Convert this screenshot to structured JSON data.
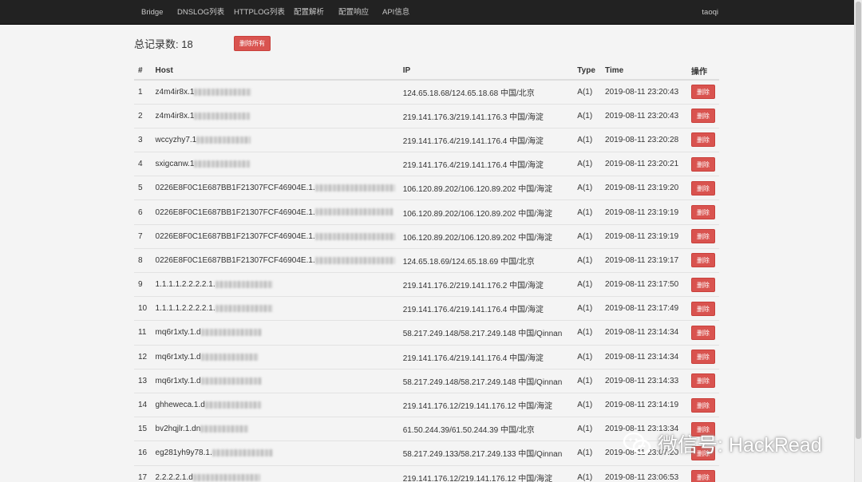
{
  "nav": {
    "items": [
      {
        "label": "Bridge"
      },
      {
        "label": "DNSLOG列表"
      },
      {
        "label": "HTTPLOG列表"
      },
      {
        "label": "配置解析"
      },
      {
        "label": "配置响应"
      },
      {
        "label": "API信息"
      }
    ],
    "user": "taoqi"
  },
  "summary": {
    "total_label": "总记录数: 18",
    "delete_all_label": "删除所有"
  },
  "table": {
    "headers": {
      "num": "#",
      "host": "Host",
      "ip": "IP",
      "type": "Type",
      "time": "Time",
      "action": "操作"
    },
    "delete_label": "删除",
    "rows": [
      {
        "num": "1",
        "host": "z4m4ir8x.1",
        "ip": "124.65.18.68/124.65.18.68 中国/北京",
        "type": "A(1)",
        "time": "2019-08-11 23:20:43"
      },
      {
        "num": "2",
        "host": "z4m4ir8x.1",
        "ip": "219.141.176.3/219.141.176.3 中国/海淀",
        "type": "A(1)",
        "time": "2019-08-11 23:20:43"
      },
      {
        "num": "3",
        "host": "wccyzhy7.1",
        "ip": "219.141.176.4/219.141.176.4 中国/海淀",
        "type": "A(1)",
        "time": "2019-08-11 23:20:28"
      },
      {
        "num": "4",
        "host": "sxigcanw.1",
        "ip": "219.141.176.4/219.141.176.4 中国/海淀",
        "type": "A(1)",
        "time": "2019-08-11 23:20:21"
      },
      {
        "num": "5",
        "host": "0226E8F0C1E687BB1F21307FCF46904E.1.",
        "ip": "106.120.89.202/106.120.89.202 中国/海淀",
        "type": "A(1)",
        "time": "2019-08-11 23:19:20"
      },
      {
        "num": "6",
        "host": "0226E8F0C1E687BB1F21307FCF46904E.1.",
        "ip": "106.120.89.202/106.120.89.202 中国/海淀",
        "type": "A(1)",
        "time": "2019-08-11 23:19:19"
      },
      {
        "num": "7",
        "host": "0226E8F0C1E687BB1F21307FCF46904E.1.",
        "ip": "106.120.89.202/106.120.89.202 中国/海淀",
        "type": "A(1)",
        "time": "2019-08-11 23:19:19"
      },
      {
        "num": "8",
        "host": "0226E8F0C1E687BB1F21307FCF46904E.1.",
        "ip": "124.65.18.69/124.65.18.69 中国/北京",
        "type": "A(1)",
        "time": "2019-08-11 23:19:17"
      },
      {
        "num": "9",
        "host": "1.1.1.1.2.2.2.2.1.",
        "ip": "219.141.176.2/219.141.176.2 中国/海淀",
        "type": "A(1)",
        "time": "2019-08-11 23:17:50"
      },
      {
        "num": "10",
        "host": "1.1.1.1.2.2.2.2.1.",
        "ip": "219.141.176.4/219.141.176.4 中国/海淀",
        "type": "A(1)",
        "time": "2019-08-11 23:17:49"
      },
      {
        "num": "11",
        "host": "mq6r1xty.1.d",
        "ip": "58.217.249.148/58.217.249.148 中国/Qinnan",
        "type": "A(1)",
        "time": "2019-08-11 23:14:34"
      },
      {
        "num": "12",
        "host": "mq6r1xty.1.d",
        "ip": "219.141.176.4/219.141.176.4 中国/海淀",
        "type": "A(1)",
        "time": "2019-08-11 23:14:34"
      },
      {
        "num": "13",
        "host": "mq6r1xty.1.d",
        "ip": "58.217.249.148/58.217.249.148 中国/Qinnan",
        "type": "A(1)",
        "time": "2019-08-11 23:14:33"
      },
      {
        "num": "14",
        "host": "ghheweca.1.d",
        "ip": "219.141.176.12/219.141.176.12 中国/海淀",
        "type": "A(1)",
        "time": "2019-08-11 23:14:19"
      },
      {
        "num": "15",
        "host": "bv2hqjlr.1.dn",
        "ip": "61.50.244.39/61.50.244.39 中国/北京",
        "type": "A(1)",
        "time": "2019-08-11 23:13:34"
      },
      {
        "num": "16",
        "host": "eg281yh9y78.1.",
        "ip": "58.217.249.133/58.217.249.133 中国/Qinnan",
        "type": "A(1)",
        "time": "2019-08-11 23:07:20"
      },
      {
        "num": "17",
        "host": "2.2.2.2.1.d",
        "ip": "219.141.176.12/219.141.176.12 中国/海淀",
        "type": "A(1)",
        "time": "2019-08-11 23:06:53"
      }
    ]
  },
  "watermark": {
    "text": "微信号: HackRead",
    "icon": "wechat-icon"
  }
}
